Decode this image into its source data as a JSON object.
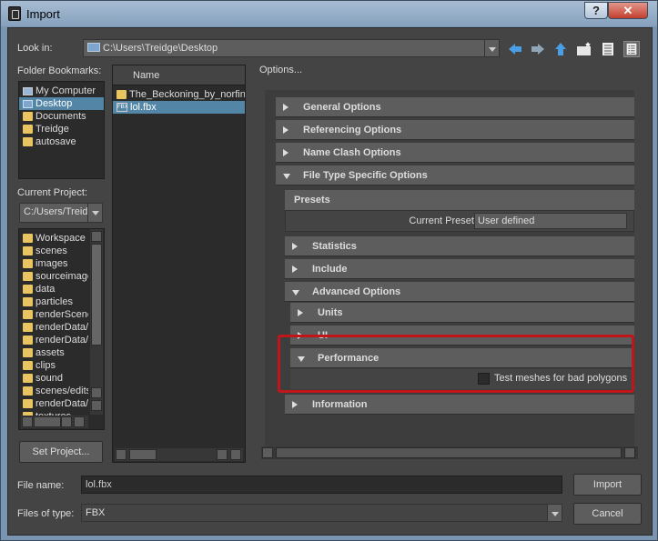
{
  "window": {
    "title": "Import",
    "help": "?",
    "close": "✕"
  },
  "look_in": {
    "label": "Look in:",
    "path": "C:\\Users\\Treidge\\Desktop"
  },
  "bookmarks": {
    "label": "Folder Bookmarks:",
    "items": [
      "My Computer",
      "Desktop",
      "Documents",
      "Treidge",
      "autosave"
    ],
    "selected": 1
  },
  "project": {
    "label": "Current Project:",
    "value": "C:/Users/Treid",
    "folders": [
      "Workspace F",
      "scenes",
      "images",
      "sourceimage",
      "data",
      "particles",
      "renderScene",
      "renderData/",
      "renderData/",
      "assets",
      "clips",
      "sound",
      "scenes/edits",
      "renderData/",
      "textures"
    ],
    "set_button": "Set Project..."
  },
  "files": {
    "header": "Name",
    "items": [
      {
        "name": "The_Beckoning_by_norfin",
        "type": "folder"
      },
      {
        "name": "lol.fbx",
        "type": "fbx"
      }
    ],
    "selected": 1
  },
  "options": {
    "label": "Options...",
    "sections": [
      "General Options",
      "Referencing Options",
      "Name Clash Options",
      "File Type Specific Options"
    ],
    "presets": {
      "title": "Presets",
      "current_label": "Current Preset:",
      "current_value": "User defined"
    },
    "sub": [
      "Statistics",
      "Include",
      "Advanced Options"
    ],
    "adv": [
      "Units",
      "UI",
      "Performance"
    ],
    "perf_check": "Test meshes for bad polygons",
    "info": "Information"
  },
  "file_name": {
    "label": "File name:",
    "value": "lol.fbx"
  },
  "file_type": {
    "label": "Files of type:",
    "value": "FBX"
  },
  "buttons": {
    "import": "Import",
    "cancel": "Cancel"
  },
  "colors": {
    "highlight": "#c0161b",
    "selection": "#5285a6"
  }
}
